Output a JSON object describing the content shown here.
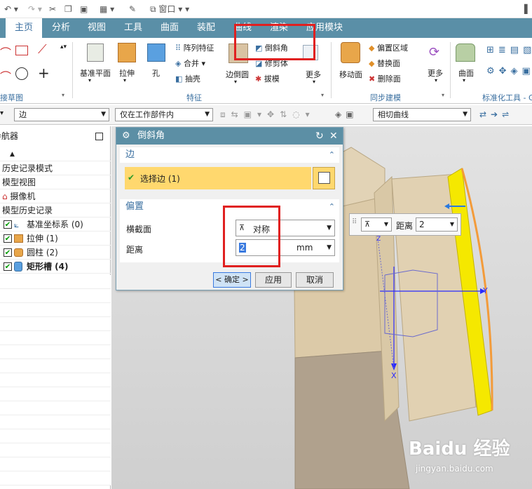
{
  "tabs": [
    "主页",
    "分析",
    "视图",
    "工具",
    "曲面",
    "装配",
    "曲线",
    "渲染",
    "应用模块"
  ],
  "window_menu": "窗口",
  "ribbon": {
    "datum_plane": "基准平面",
    "extrude": "拉伸",
    "hole": "孔",
    "pattern_feature": "阵列特征",
    "unite": "合并",
    "shell": "抽壳",
    "edge_blend": "边倒圆",
    "chamfer": "倒斜角",
    "trim_body": "修剪体",
    "draft": "拔模",
    "more": "更多",
    "move_face": "移动面",
    "offset_region": "偏置区域",
    "replace_face": "替换面",
    "delete_face": "删除面",
    "surface": "曲面",
    "group_sketch": "接草图",
    "group_feature": "特征",
    "group_sync": "同步建模",
    "group_std": "标准化工具 - G"
  },
  "selbar": {
    "filter": "边",
    "scope": "仅在工作部件内",
    "curve_rule": "相切曲线"
  },
  "navigator": {
    "title": "导航器",
    "rows": [
      "历史记录模式",
      "模型视图",
      "摄像机",
      "模型历史记录"
    ],
    "features": [
      {
        "label": "基准坐标系 (0)",
        "bold": false
      },
      {
        "label": "拉伸 (1)",
        "bold": false
      },
      {
        "label": "圆柱 (2)",
        "bold": false
      },
      {
        "label": "矩形槽 (4)",
        "bold": true
      }
    ]
  },
  "dialog": {
    "title": "倒斜角",
    "edge_section": "边",
    "select_edge": "选择边 (1)",
    "offset_section": "偏置",
    "cross_section_label": "横截面",
    "cross_section_value": "对称",
    "distance_label": "距离",
    "distance_value": "2",
    "unit": "mm",
    "ok": "< 确定 >",
    "apply": "应用",
    "cancel": "取消"
  },
  "annotation": {
    "distance_label": "距离",
    "distance_value": "2"
  },
  "axes": {
    "x": "X",
    "y": "Y",
    "z": "Z"
  },
  "watermark": {
    "brand": "Baidu 经验",
    "url": "jingyan.baidu.com"
  },
  "colors": {
    "accent": "#5a8fa7",
    "highlight": "#ffd86e",
    "red": "#e02020",
    "face": "#ddccab",
    "chamfer": "#f5e800"
  }
}
